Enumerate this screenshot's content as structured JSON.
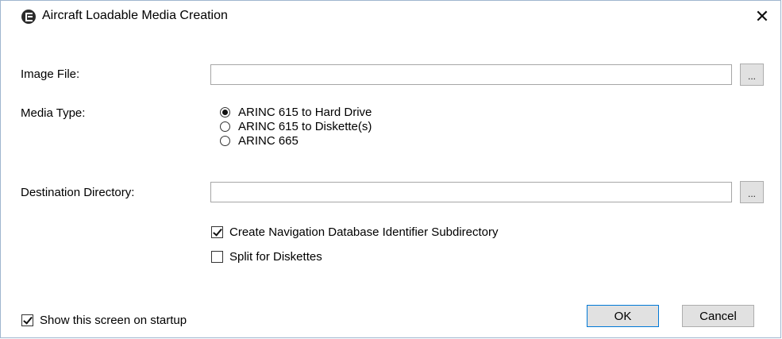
{
  "window": {
    "title": "Aircraft Loadable Media Creation",
    "close_symbol": "✕",
    "app_icon": "app-logo-icon"
  },
  "image_file": {
    "label": "Image File:",
    "value": "",
    "browse_label": "..."
  },
  "media_type": {
    "label": "Media Type:",
    "options": [
      {
        "label": "ARINC 615 to Hard Drive",
        "selected": true
      },
      {
        "label": "ARINC 615 to Diskette(s)",
        "selected": false
      },
      {
        "label": "ARINC 665",
        "selected": false
      }
    ]
  },
  "destination": {
    "label": "Destination Directory:",
    "value": "",
    "browse_label": "..."
  },
  "options": {
    "create_nav_db": {
      "label": "Create Navigation Database Identifier Subdirectory",
      "checked": true
    },
    "split_diskettes": {
      "label": "Split for Diskettes",
      "checked": false
    }
  },
  "footer": {
    "show_on_startup": {
      "label": "Show this screen on startup",
      "checked": true
    },
    "ok_label": "OK",
    "cancel_label": "Cancel"
  },
  "colors": {
    "accent": "#0078d7",
    "button_bg": "#e1e1e1",
    "border": "#a6a6a6"
  }
}
